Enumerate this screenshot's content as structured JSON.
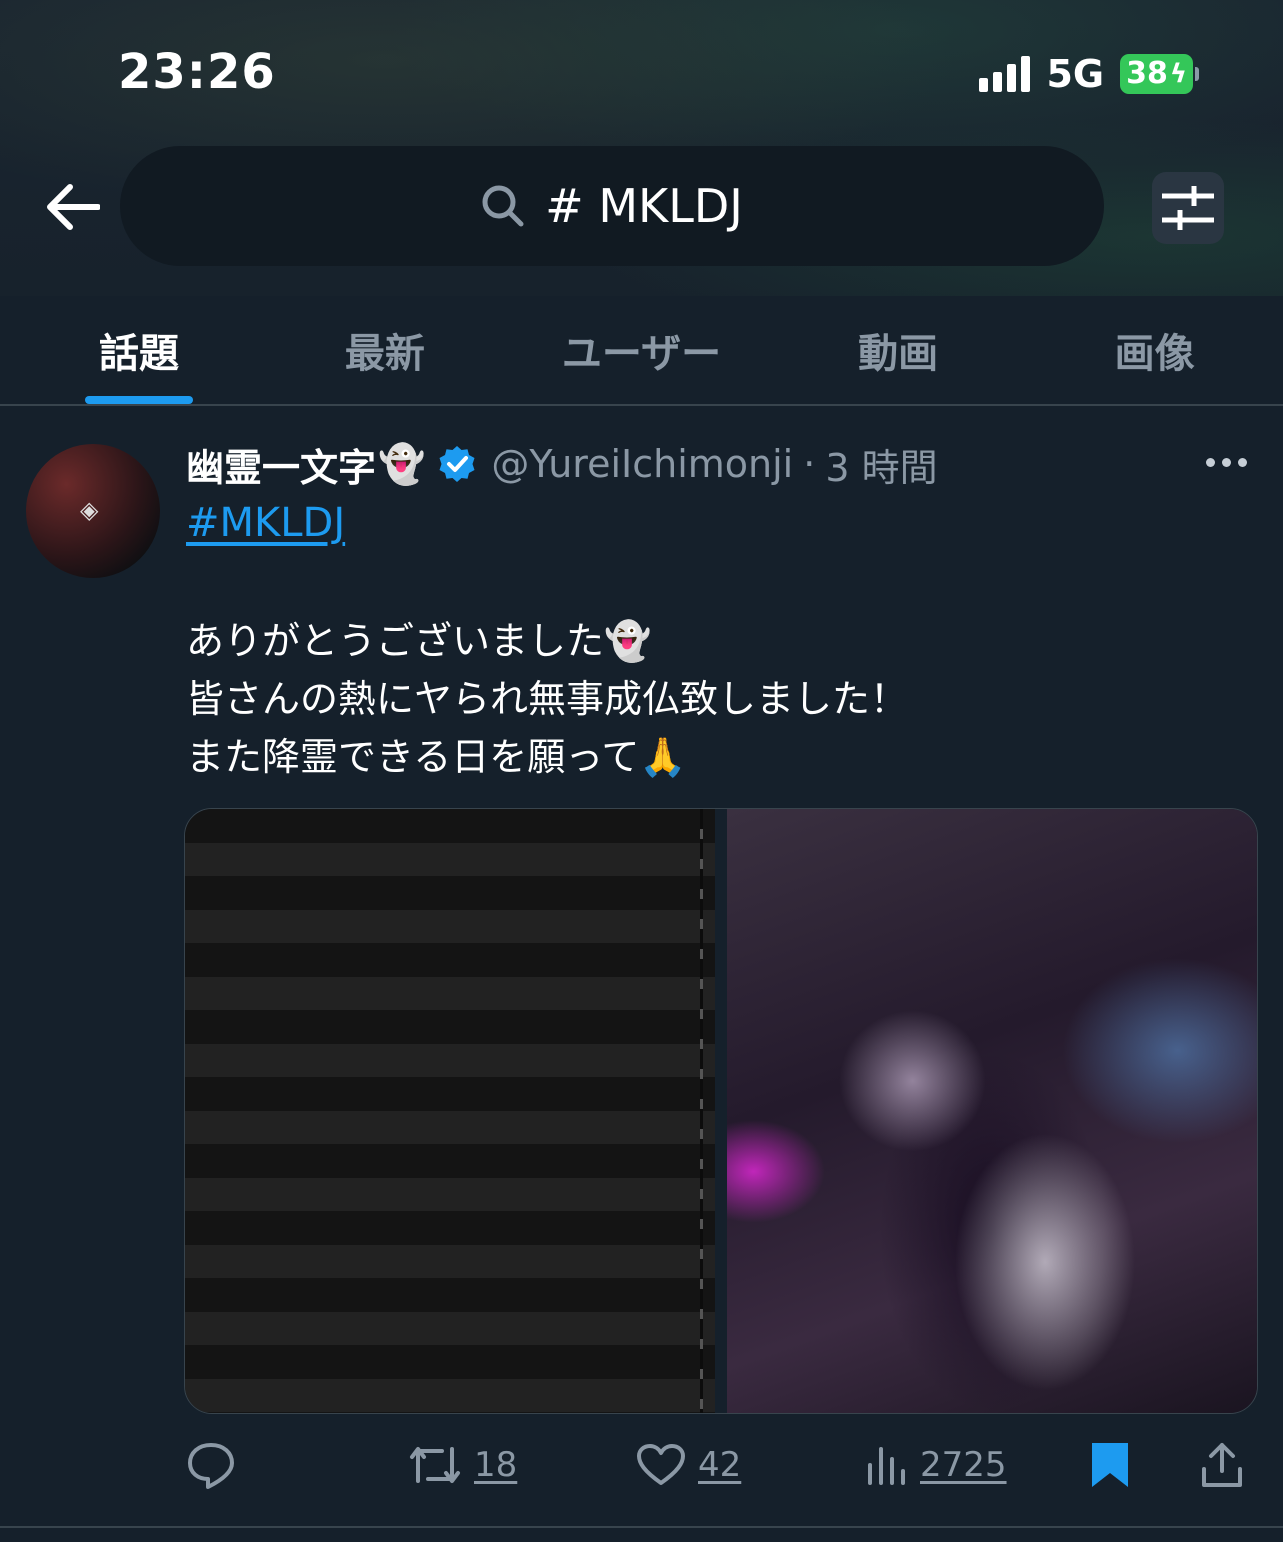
{
  "status_bar": {
    "time": "23:26",
    "network": "5G",
    "battery": "38",
    "battery_color": "#34c759"
  },
  "search": {
    "query": "# MKLDJ",
    "icon": "search-icon"
  },
  "tabs": [
    {
      "label": "話題",
      "active": true
    },
    {
      "label": "最新",
      "active": false
    },
    {
      "label": "ユーザー",
      "active": false
    },
    {
      "label": "動画",
      "active": false
    },
    {
      "label": "画像",
      "active": false
    }
  ],
  "post": {
    "display_name": "幽霊一文字",
    "name_emoji": "👻",
    "handle": "@YureiIchimonji",
    "separator": "·",
    "time": "3 時間",
    "hashtag": "#MKLDJ",
    "lines": [
      "ありがとうございました👻",
      "皆さんの熱にヤられ無事成仏致しました！",
      "また降霊できる日を願って🙏"
    ],
    "stats": {
      "reposts": "18",
      "likes": "42",
      "views": "2725"
    },
    "colors": {
      "accent": "#1d9bf0",
      "muted": "#8b98a5",
      "background": "#15202b"
    }
  }
}
